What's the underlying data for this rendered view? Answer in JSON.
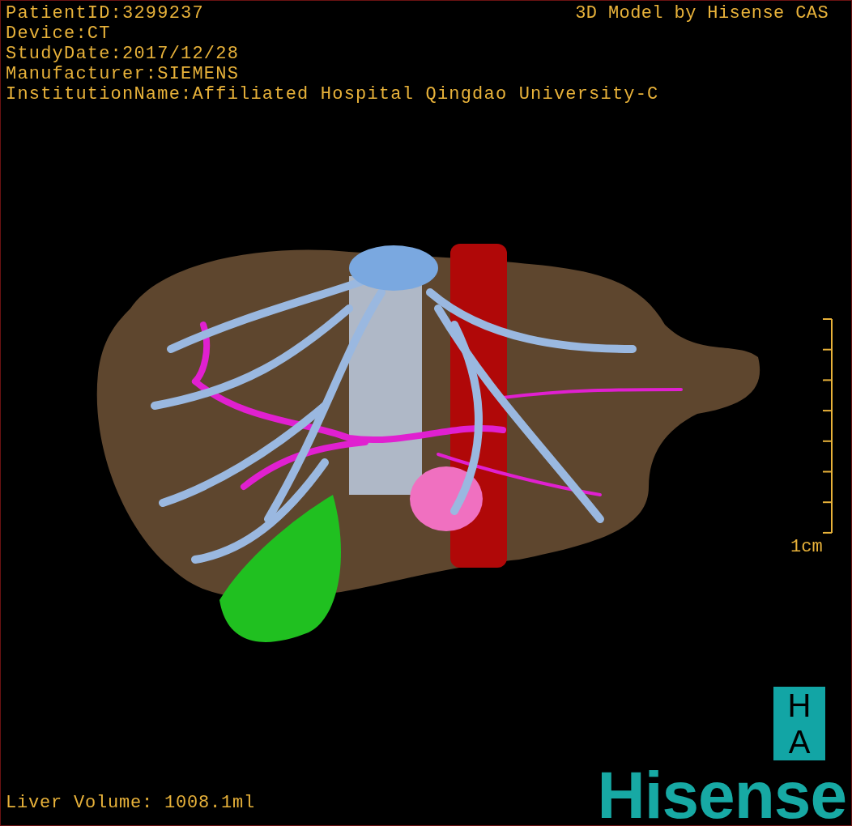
{
  "header": {
    "lines": [
      "PatientID:3299237",
      "Device:CT",
      "StudyDate:2017/12/28",
      "Manufacturer:SIEMENS",
      "InstitutionName:Affiliated Hospital Qingdao University-C"
    ]
  },
  "credit": "3D Model by Hisense CAS",
  "scale_bar": {
    "label": "1cm"
  },
  "orientation_marker": {
    "letters": [
      "H",
      "A"
    ]
  },
  "logo": "Hisense",
  "footer": {
    "liver_volume": "Liver Volume: 1008.1ml"
  }
}
